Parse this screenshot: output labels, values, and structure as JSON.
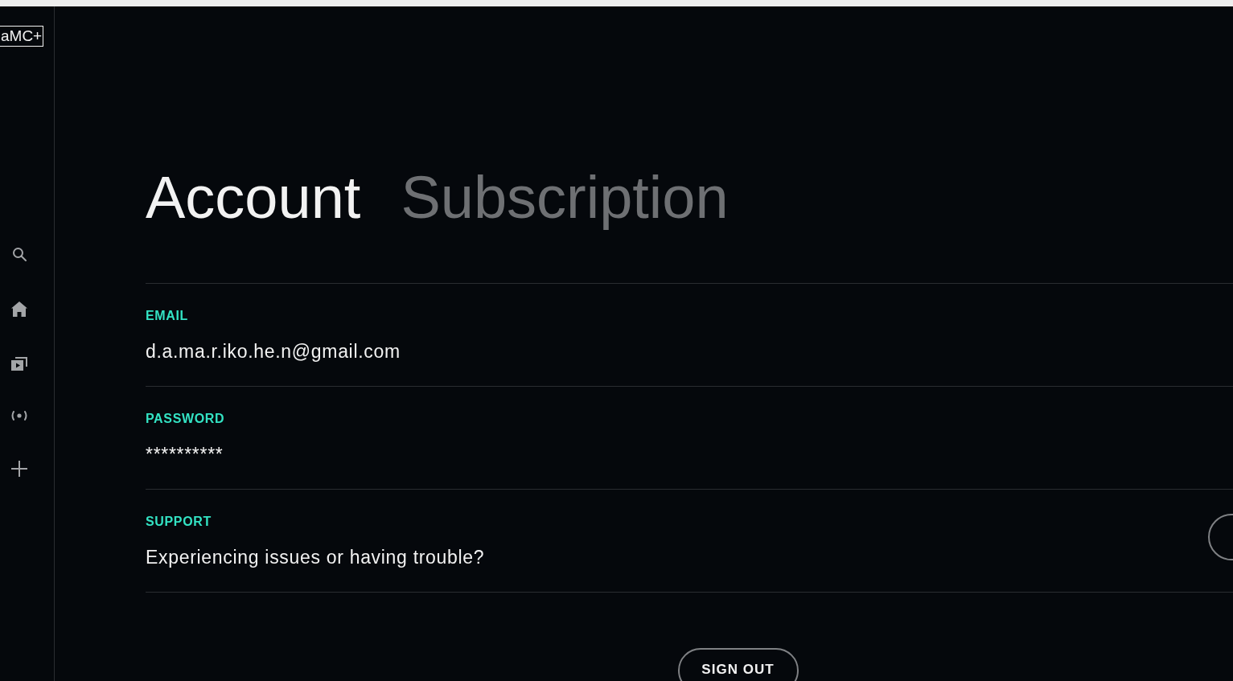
{
  "sidebar": {
    "logo": "aMC+"
  },
  "tabs": [
    {
      "label": "Account",
      "selected": true
    },
    {
      "label": "Subscription",
      "selected": false
    }
  ],
  "sections": [
    {
      "kind": "info",
      "label": "EMAIL",
      "value": "d.a.ma.r.iko.he.n@gmail.com"
    },
    {
      "kind": "info",
      "label": "PASSWORD",
      "value": "**********"
    },
    {
      "kind": "action",
      "label": "SUPPORT",
      "value": "Experiencing issues or having trouble?"
    }
  ],
  "sign_out": {
    "label": "SIGN OUT"
  }
}
